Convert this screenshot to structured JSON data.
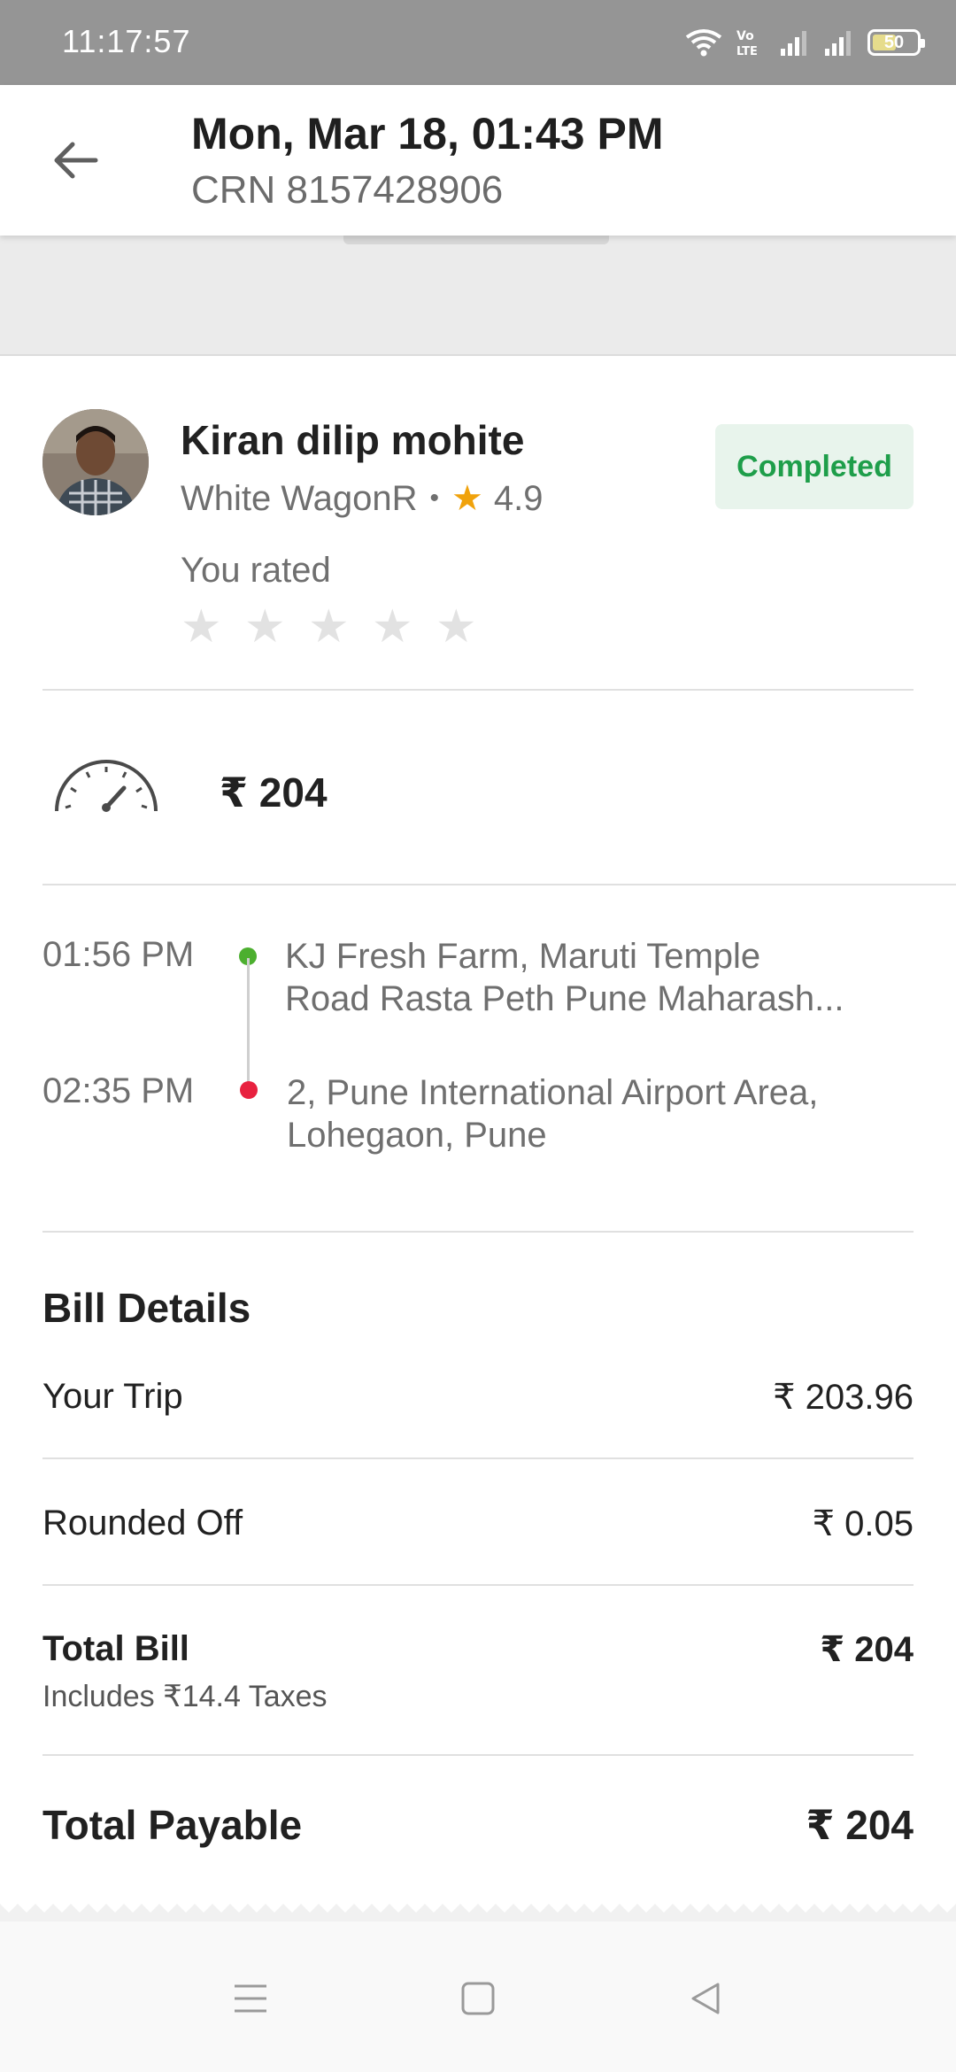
{
  "status_bar": {
    "time": "11:17:57",
    "battery": "50"
  },
  "header": {
    "title": "Mon, Mar 18, 01:43 PM",
    "crn": "CRN 8157428906"
  },
  "driver": {
    "name": "Kiran dilip mohite",
    "car": "White WagonR",
    "separator": "•",
    "rating": "4.9",
    "status": "Completed",
    "you_rated_label": "You rated",
    "user_rating_stars": 0
  },
  "fare": {
    "amount": "₹ 204"
  },
  "route": {
    "pickup_time": "01:56 PM",
    "pickup_address_line1": "KJ Fresh Farm, Maruti Temple",
    "pickup_address_line2": "Road Rasta Peth Pune Maharash...",
    "drop_time": "02:35 PM",
    "drop_address_line1": "2, Pune International Airport Area,",
    "drop_address_line2": "Lohegaon, Pune"
  },
  "bill": {
    "heading": "Bill Details",
    "rows": [
      {
        "label": "Your Trip",
        "value": "₹ 203.96"
      },
      {
        "label": "Rounded Off",
        "value": "₹ 0.05"
      },
      {
        "label": "Total Bill",
        "value": "₹ 204",
        "note": "Includes ₹14.4 Taxes"
      }
    ],
    "total_payable_label": "Total Payable",
    "total_payable_value": "₹ 204"
  },
  "colors": {
    "status_bar": "#959595",
    "completed_bg": "#e8f4ec",
    "completed_text": "#1e9e4a",
    "rating_star": "#f0a20b",
    "pickup_dot": "#4caf2f",
    "drop_dot": "#e8213f"
  },
  "icons": {
    "back": "arrow-left-icon",
    "meter": "speedometer-icon",
    "nav_menu": "menu-icon",
    "nav_home": "square-icon",
    "nav_back": "triangle-back-icon"
  }
}
